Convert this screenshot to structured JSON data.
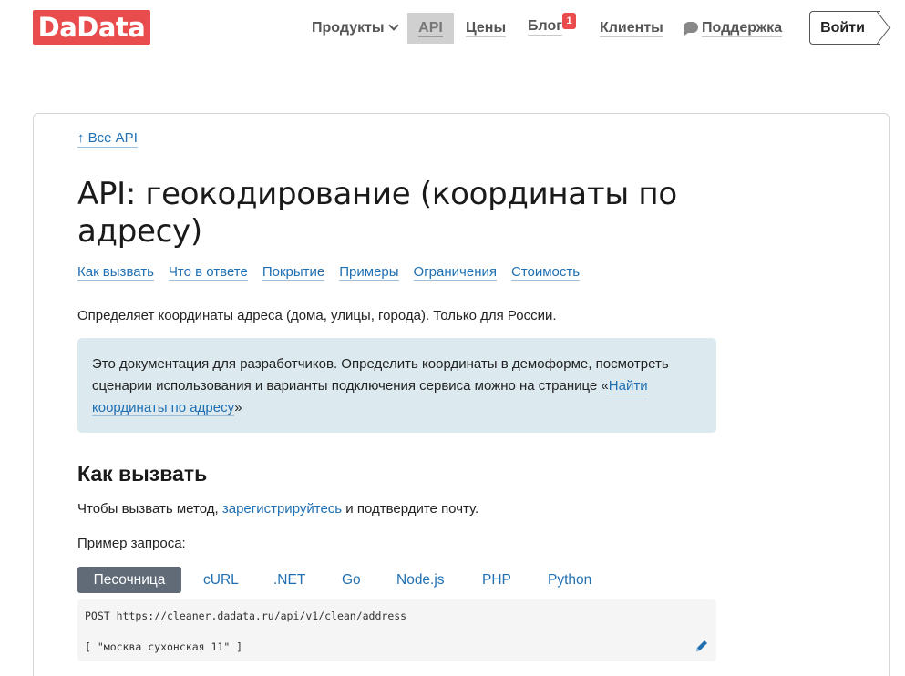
{
  "header": {
    "logo": "DaData",
    "nav": {
      "products": "Продукты",
      "api": "API",
      "prices": "Цены",
      "blog": "Блог",
      "blog_badge": "1",
      "clients": "Клиенты",
      "support": "Поддержка"
    },
    "login": "Войти"
  },
  "page": {
    "back_link": "↑ Все API",
    "title": "API: геокодирование (координаты по адресу)",
    "toc": [
      "Как вызвать",
      "Что в ответе",
      "Покрытие",
      "Примеры",
      "Ограничения",
      "Стоимость"
    ],
    "description": "Определяет координаты адреса (дома, улицы, города). Только для России.",
    "info": {
      "text_before": "Это документация для разработчиков. Определить координаты в демоформе, посмотреть сценарии использования и варианты подключения сервиса можно на странице «",
      "link": "Найти координаты по адресу",
      "text_after": "»"
    },
    "section_title": "Как вызвать",
    "call": {
      "before": "Чтобы вызвать метод, ",
      "link": "зарегистрируйтесь",
      "after": " и подтвердите почту."
    },
    "example_label": "Пример запроса:",
    "tabs": [
      "Песочница",
      "cURL",
      ".NET",
      "Go",
      "Node.js",
      "PHP",
      "Python"
    ],
    "code": {
      "line1": "POST https://cleaner.dadata.ru/api/v1/clean/address",
      "line2": "[ \"москва сухонская 11\" ]"
    }
  },
  "colors": {
    "brand": "#e94c4c",
    "link": "#1f6fb2",
    "info_bg": "#dceaf0",
    "active_tab": "#606b77"
  }
}
